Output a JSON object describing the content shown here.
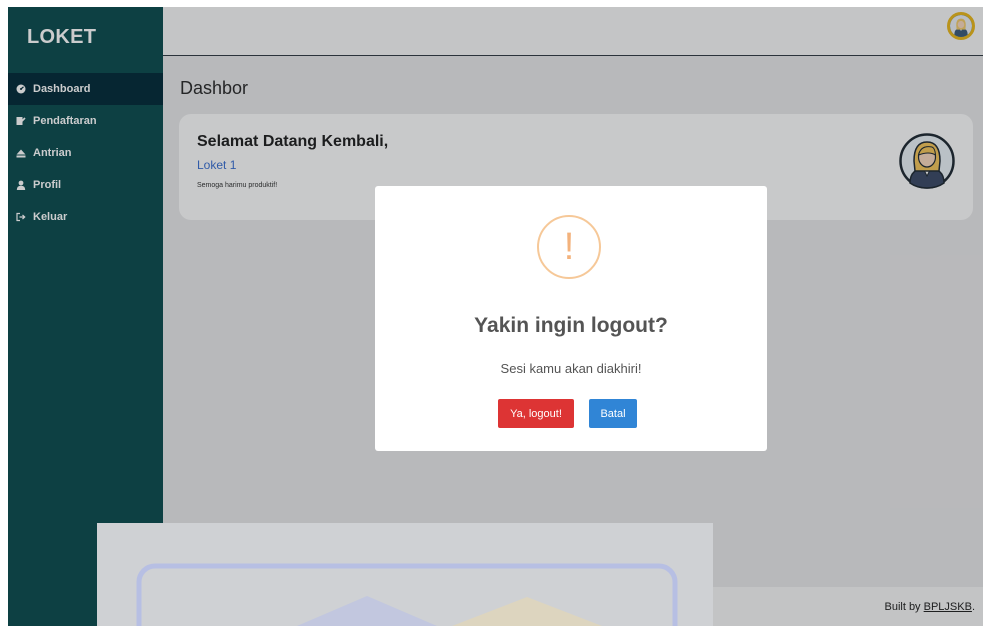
{
  "sidebar": {
    "brand": "LOKET",
    "items": [
      {
        "label": "Dashboard",
        "icon": "dashboard-icon",
        "active": true
      },
      {
        "label": "Pendaftaran",
        "icon": "register-icon"
      },
      {
        "label": "Antrian",
        "icon": "eject-icon"
      },
      {
        "label": "Profil",
        "icon": "user-icon"
      },
      {
        "label": "Keluar",
        "icon": "logout-icon"
      }
    ]
  },
  "main": {
    "page_title": "Dashbor",
    "welcome": {
      "title": "Selamat Datang Kembali,",
      "name": "Loket 1",
      "note": "Semoga harimu produktif!"
    }
  },
  "footer": {
    "prefix": "Built by ",
    "link": "BPLJSKB",
    "suffix": "."
  },
  "modal": {
    "icon": "!",
    "title": "Yakin ingin logout?",
    "text": "Sesi kamu akan diakhiri!",
    "confirm_label": "Ya, logout!",
    "cancel_label": "Batal"
  },
  "colors": {
    "sidebar": "#0c4c4f",
    "sidebar_active": "#032b39",
    "confirm": "#dd3434",
    "cancel": "#3085d6",
    "warning": "#f6c898",
    "link": "#3a6fd0"
  }
}
